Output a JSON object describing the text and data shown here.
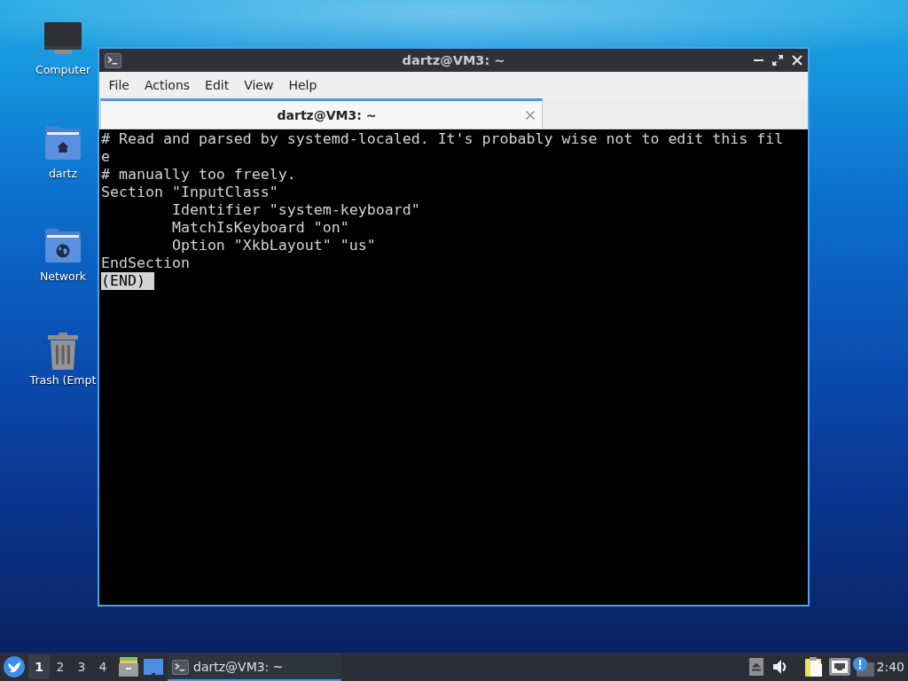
{
  "desktop": {
    "icons": [
      {
        "kind": "computer",
        "label": "Computer"
      },
      {
        "kind": "home-folder",
        "label": "dartz"
      },
      {
        "kind": "network-folder",
        "label": "Network"
      },
      {
        "kind": "trash",
        "label": "Trash (Empt"
      }
    ]
  },
  "window": {
    "title": "dartz@VM3: ~",
    "menu": [
      "File",
      "Actions",
      "Edit",
      "View",
      "Help"
    ],
    "tabs": [
      {
        "label": "dartz@VM3: ~",
        "selected": true
      }
    ],
    "terminal": {
      "lines": [
        {
          "text": "# Read and parsed by systemd-localed. It's probably wise not to edit this fil"
        },
        {
          "text": "e"
        },
        {
          "text": "# manually too freely."
        },
        {
          "text": "Section \"InputClass\"",
          "children": [
            {
              "text": "Identifier \"system-keyboard\""
            },
            {
              "text": "MatchIsKeyboard \"on\""
            },
            {
              "text": "Option \"XkbLayout\" \"us\""
            }
          ]
        },
        {
          "text": "EndSection"
        }
      ],
      "status": "(END)"
    }
  },
  "taskbar": {
    "workspaces": [
      {
        "label": "1",
        "selected": true
      },
      {
        "label": "2",
        "selected": false
      },
      {
        "label": "3",
        "selected": false
      },
      {
        "label": "4",
        "selected": false
      }
    ],
    "tasks": [
      {
        "label": "dartz@VM3: ~",
        "selected": true
      }
    ],
    "clock": "2:40"
  }
}
